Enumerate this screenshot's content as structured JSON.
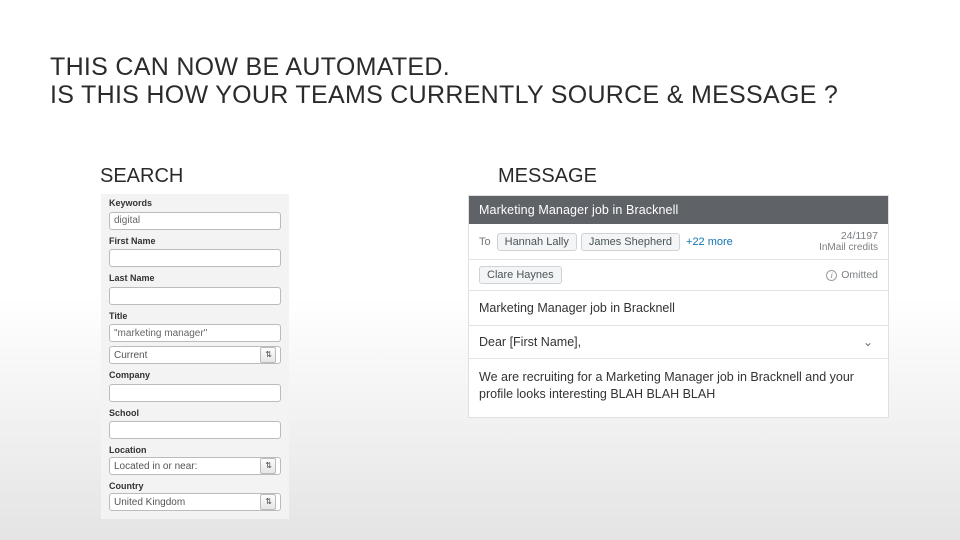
{
  "heading_line1": "THIS CAN NOW BE AUTOMATED.",
  "heading_line2": "IS THIS HOW YOUR TEAMS CURRENTLY SOURCE & MESSAGE ?",
  "columns": {
    "search": "SEARCH",
    "message": "MESSAGE"
  },
  "search": {
    "keywords_label": "Keywords",
    "keywords_value": "digital",
    "firstname_label": "First Name",
    "firstname_value": "",
    "lastname_label": "Last Name",
    "lastname_value": "",
    "title_label": "Title",
    "title_value": "\"marketing manager\"",
    "title_scope": "Current",
    "company_label": "Company",
    "company_value": "",
    "school_label": "School",
    "school_value": "",
    "location_label": "Location",
    "location_value": "Located in or near:",
    "country_label": "Country",
    "country_value": "United Kingdom"
  },
  "message": {
    "header": "Marketing Manager job in Bracknell",
    "to_label": "To",
    "recipients": [
      "Hannah Lally",
      "James Shepherd"
    ],
    "more": "+22 more",
    "credits_count": "24/1197",
    "credits_label": "InMail credits",
    "secondary_recipients": [
      "Clare Haynes"
    ],
    "omitted_label": "Omitted",
    "subject": "Marketing Manager job in Bracknell",
    "greeting": "Dear [First Name],",
    "body": "We are recruiting for a Marketing Manager job in Bracknell and your profile looks interesting BLAH BLAH BLAH"
  }
}
